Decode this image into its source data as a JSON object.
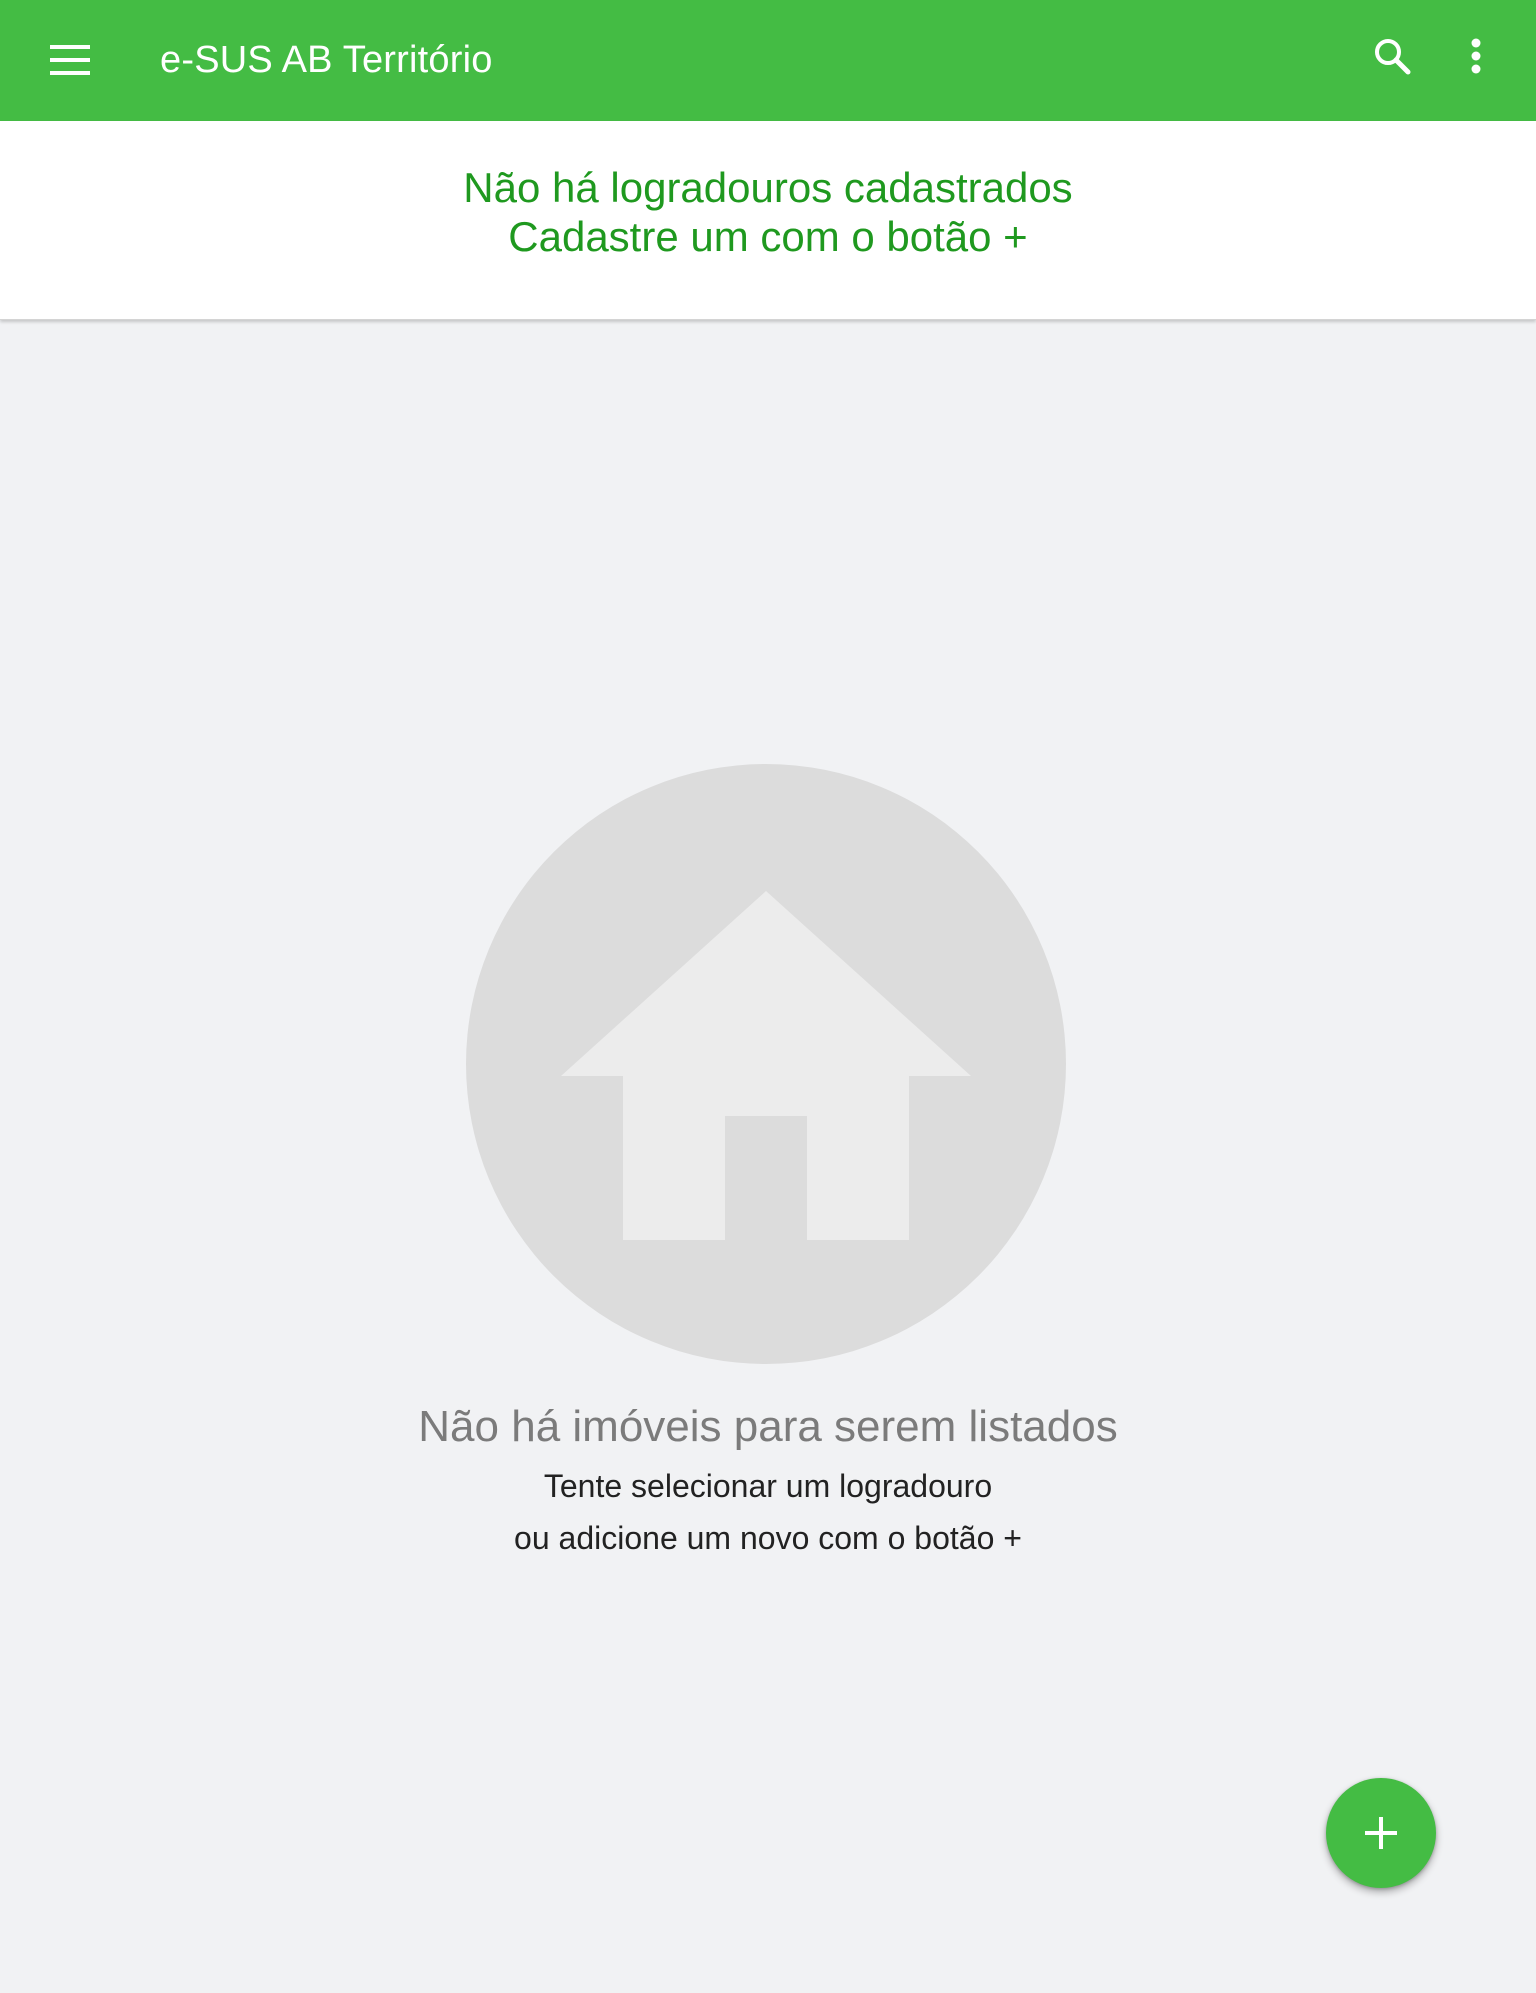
{
  "app_bar": {
    "title": "e-SUS AB Território",
    "background_color": "#44bc44",
    "icons": [
      "menu-icon",
      "search-icon",
      "more-vert-icon"
    ]
  },
  "banner": {
    "line1": "Não há logradouros cadastrados",
    "line2": "Cadastre um com o botão +",
    "text_color": "#1f991f"
  },
  "empty_state": {
    "icon": "house-icon",
    "title": "Não há imóveis para serem listados",
    "hint_line1": "Tente selecionar um logradouro",
    "hint_line2": "ou adicione um novo com o botão +"
  },
  "fab": {
    "icon": "plus-icon",
    "color": "#44bc44"
  }
}
